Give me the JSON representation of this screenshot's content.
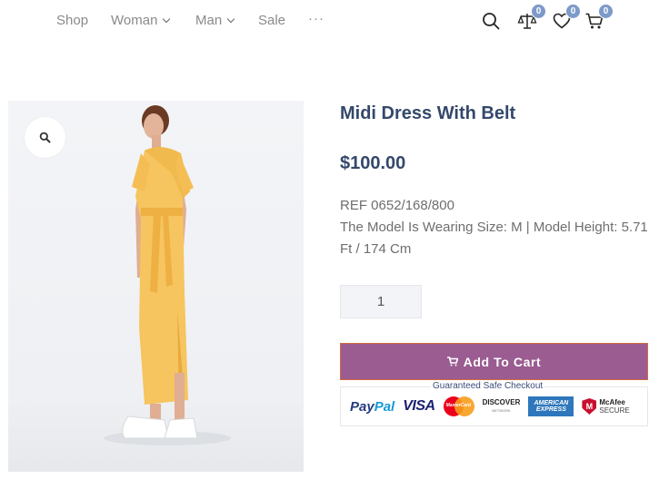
{
  "nav": {
    "items": [
      {
        "label": "Shop"
      },
      {
        "label": "Woman"
      },
      {
        "label": "Man"
      },
      {
        "label": "Sale"
      },
      {
        "label": "···"
      }
    ]
  },
  "header_icons": {
    "compare_count": "0",
    "wishlist_count": "0",
    "cart_count": "0"
  },
  "product": {
    "title": "Midi Dress With Belt",
    "price": "$100.00",
    "ref": "REF 0652/168/800",
    "model_info": "The Model Is Wearing Size: M | Model Height: 5.71 Ft / 174 Cm",
    "quantity": "1",
    "add_to_cart_label": "Add To Cart"
  },
  "checkout": {
    "label": "Guaranteed Safe Checkout",
    "paypal_1": "Pay",
    "paypal_2": "Pal",
    "visa": "VISA",
    "mastercard": "MasterCard",
    "discover": "DISCOVER",
    "discover_sub": "NETWORK",
    "amex_1": "AMERICAN",
    "amex_2": "EXPRESS",
    "mcafee_1": "McAfee",
    "mcafee_2": "SECURE"
  },
  "colors": {
    "accent": "#9a5c91",
    "title": "#34486b",
    "badge": "#7d9ac9"
  }
}
